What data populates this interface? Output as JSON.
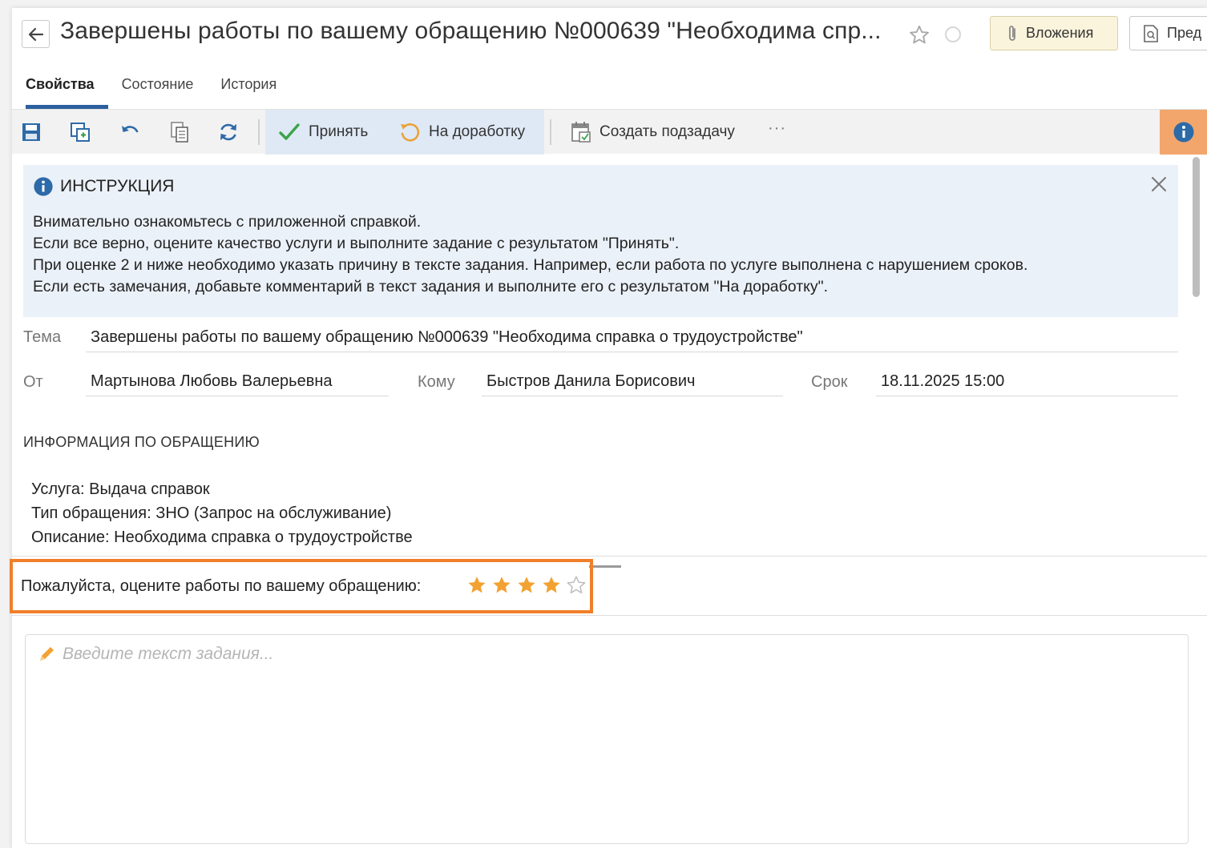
{
  "title_bar": {
    "title": "Завершены работы по вашему обращению №000639 \"Необходима спр...",
    "attachments_label": "Вложения",
    "preview_label": "Пред"
  },
  "tabs": [
    {
      "label": "Свойства",
      "active": true
    },
    {
      "label": "Состояние",
      "active": false
    },
    {
      "label": "История",
      "active": false
    }
  ],
  "toolbar": {
    "icons": [
      "save-icon",
      "save-copy-icon",
      "undo-icon",
      "copy-icon",
      "refresh-icon"
    ],
    "accept_label": "Принять",
    "rework_label": "На доработку",
    "subtask_label": "Создать подзадачу",
    "more_label": "···",
    "accent_color": "#f2a66c"
  },
  "instruction": {
    "heading": "ИНСТРУКЦИЯ",
    "lines": [
      "Внимательно ознакомьтесь с приложенной справкой.",
      "Если все верно, оцените качество услуги и выполните задание с результатом \"Принять\".",
      "При оценке 2 и ниже необходимо указать причину в тексте задания. Например, если работа по услуге выполнена с нарушением сроков.",
      "Если есть замечания, добавьте комментарий в текст задания и выполните его с результатом \"На доработку\"."
    ]
  },
  "fields": {
    "subject_label": "Тема",
    "subject_value": "Завершены работы по вашему обращению №000639 \"Необходима справка о трудоустройстве\"",
    "from_label": "От",
    "from_value": "Мартынова Любовь Валерьевна",
    "to_label": "Кому",
    "to_value": "Быстров Данила Борисович",
    "due_label": "Срок",
    "due_value": "18.11.2025 15:00"
  },
  "request_info": {
    "heading": "ИНФОРМАЦИЯ ПО ОБРАЩЕНИЮ",
    "lines": [
      "Услуга: Выдача справок",
      "Тип обращения: ЗНО (Запрос на обслуживание)",
      "Описание: Необходима справка о трудоустройстве"
    ]
  },
  "rating": {
    "label": "Пожалуйста, оцените работы по вашему обращению:",
    "value": 4,
    "max": 5,
    "star_color": "#f2a233",
    "highlight_color": "#f07f2a"
  },
  "task_text": {
    "placeholder": "Введите текст задания..."
  }
}
